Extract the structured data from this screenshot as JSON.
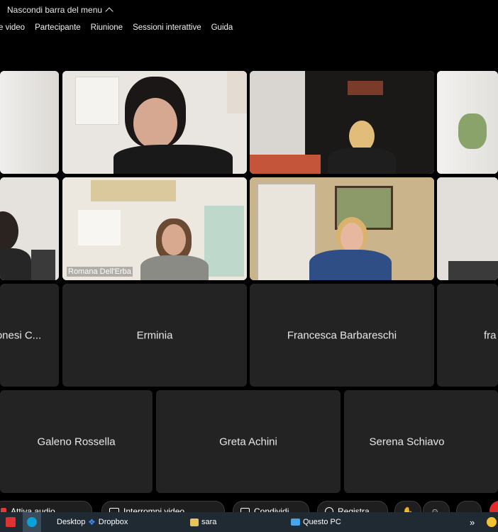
{
  "topbar": {
    "hide_menu": "Nascondi barra del menu"
  },
  "menu": {
    "items": [
      "e video",
      "Partecipante",
      "Riunione",
      "Sessioni interattive",
      "Guida"
    ]
  },
  "participants": {
    "row3": [
      "onesi C...",
      "Erminia",
      "Francesca Barbareschi",
      "fra"
    ],
    "row4": [
      "Galeno Rossella",
      "Greta Achini",
      "Serena Schiavo"
    ],
    "video_label": "Romana Dell'Erba"
  },
  "controls": {
    "audio": "Attiva audio",
    "video": "Interrompi video",
    "share": "Condividi",
    "record": "Registra",
    "more": "..."
  },
  "taskbar": {
    "desktop": "Desktop",
    "dropbox": "Dropbox",
    "sara": "sara",
    "questo_pc": "Questo PC",
    "overflow": "»"
  },
  "colors": {
    "accent": "#6fb6ff",
    "tile": "#232323",
    "taskbar": "#1f2a33"
  }
}
